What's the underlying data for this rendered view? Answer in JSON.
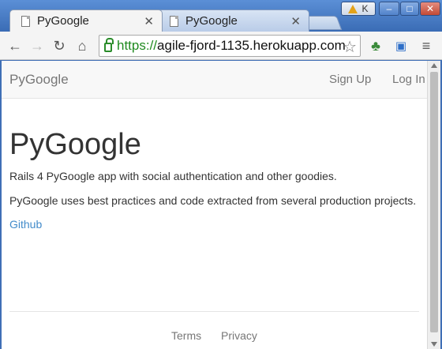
{
  "browser": {
    "tabs": [
      {
        "title": "PyGoogle",
        "active": true
      },
      {
        "title": "PyGoogle",
        "active": false
      }
    ],
    "profile_initial": "K",
    "url_scheme": "https://",
    "url_host": "agile-fjord-1135.herokuapp.com",
    "accent_secure": "#1f8a1f"
  },
  "navbar": {
    "brand": "PyGoogle",
    "links": [
      "Sign Up",
      "Log In"
    ]
  },
  "main": {
    "title": "PyGoogle",
    "paragraphs": [
      "Rails 4 PyGoogle app with social authentication and other goodies.",
      "PyGoogle uses best practices and code extracted from several production projects."
    ],
    "github_link": "Github"
  },
  "footer": {
    "links": [
      "Terms",
      "Privacy"
    ]
  },
  "colors": {
    "link": "#428bca",
    "navbar_bg": "#f8f8f8"
  }
}
